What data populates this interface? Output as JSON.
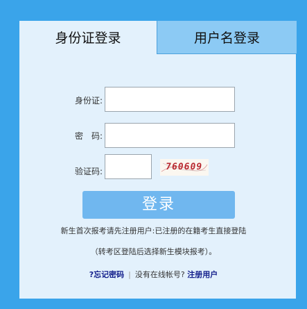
{
  "tabs": [
    {
      "label": "身份证登录"
    },
    {
      "label": "用户名登录"
    }
  ],
  "form": {
    "id_label": "身份证:",
    "id_value": "",
    "password_label": "密　码:",
    "password_value": "",
    "captcha_label": "验证码:",
    "captcha_value": "",
    "captcha_image_text": "760609",
    "login_label": "登录"
  },
  "notes": {
    "line1": "新生首次报考请先注册用户:已注册的在籍考生直接登陆",
    "line2": "（转考区登陆后选择新生模块报考）。"
  },
  "links": {
    "forgot_password": "?忘记密码",
    "separator": "|",
    "no_account_text": "没有在线帐号?",
    "register": "注册用户"
  },
  "colors": {
    "background": "#3aa4ea",
    "panel": "#e3f1fc",
    "inactive_tab": "#8ccaf4",
    "button": "#70b7ef",
    "link": "#14208c",
    "captcha_text": "#b8282f"
  }
}
